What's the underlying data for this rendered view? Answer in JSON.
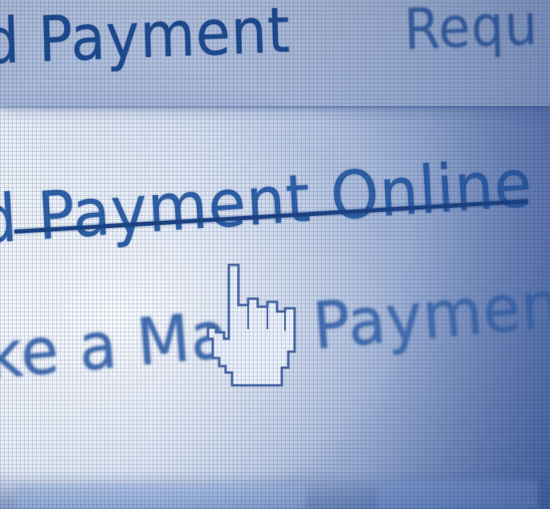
{
  "screen": {
    "menu_items": [
      {
        "label": "d Payment"
      },
      {
        "label": "Requ"
      }
    ],
    "main_link": {
      "label": "d Payment Online",
      "underlined": true
    },
    "third_item": {
      "label": "ke a Mass Payment"
    }
  },
  "cursor": {
    "icon": "hand-pointer-icon"
  },
  "colors": {
    "text_primary": "#1f4d92",
    "link": "#2f62a8",
    "underline": "#1d4486",
    "background_light": "#e9eef6",
    "background_dark": "#5d78b1"
  }
}
